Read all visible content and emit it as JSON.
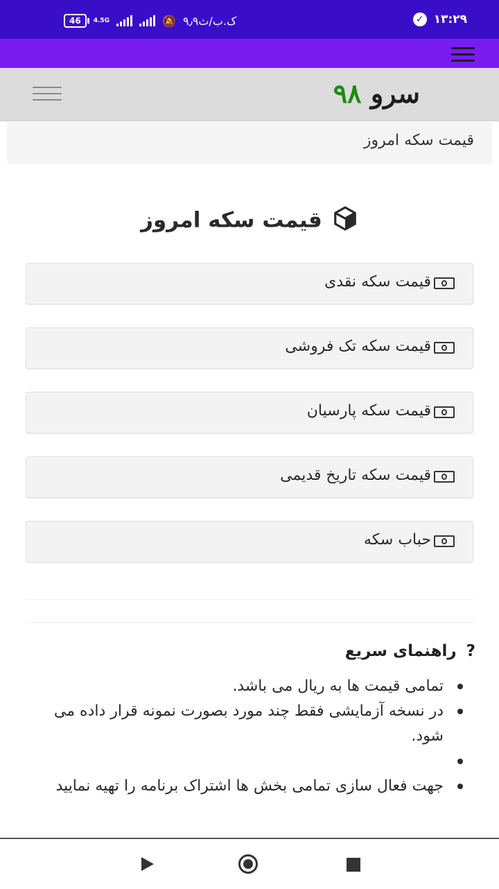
{
  "status_bar": {
    "battery": "46",
    "network": "4.5G",
    "data_speed": "۹٫۹ک.ب/ث",
    "time": "۱۳:۲۹"
  },
  "header": {
    "brand_word": "سرو",
    "brand_number": "۹۸",
    "brand_number_color": "#1f8a14"
  },
  "breadcrumb": "قیمت سکه امروز",
  "page_title": "قیمت سکه امروز",
  "items": [
    {
      "label": "قیمت سکه نقدی",
      "icon": "money-icon"
    },
    {
      "label": "قیمت سکه تک فروشی",
      "icon": "money-icon"
    },
    {
      "label": "قیمت سکه پارسیان",
      "icon": "money-icon"
    },
    {
      "label": "قیمت سکه تاریخ قدیمی",
      "icon": "money-icon"
    },
    {
      "label": "حباب سکه",
      "icon": "money-icon"
    }
  ],
  "guide": {
    "title": "راهنمای سریع",
    "points": [
      "تمامی قیمت ها به ریال می باشد.",
      "در نسخه آزمایشی فقط چند مورد بصورت نمونه قرار داده می شود.",
      "",
      "جهت فعال سازی تمامی بخش ها اشتراک برنامه را تهیه نمایید"
    ]
  },
  "colors": {
    "status_bar": "#3a0ec9",
    "nav_bar": "#7a1cf0",
    "header_bg": "#dcdcdc"
  }
}
